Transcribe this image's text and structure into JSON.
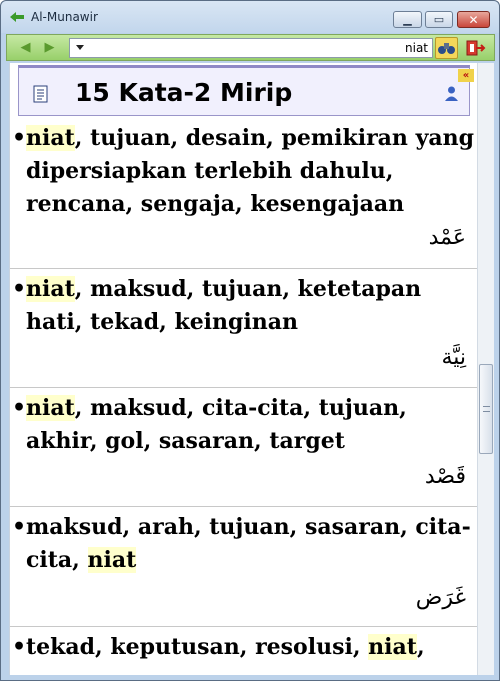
{
  "window": {
    "title": "Al-Munawir"
  },
  "toolbar": {
    "search_value": "niat"
  },
  "header": {
    "title": "15 Kata-2 Mirip",
    "collapse_label": "«"
  },
  "entries": [
    {
      "lines": [
        [
          "niat",
          ", tujuan, desain, pemikiran yang"
        ],
        [
          "",
          "dipersiapkan terlebih dahulu,"
        ],
        [
          "",
          "rencana, sengaja, kesengajaan"
        ]
      ],
      "arabic": "عَمْد"
    },
    {
      "lines": [
        [
          "niat",
          ", maksud, tujuan, ketetapan"
        ],
        [
          "",
          "hati, tekad, keinginan"
        ]
      ],
      "arabic": "نِيَّة"
    },
    {
      "lines": [
        [
          "niat",
          ", maksud, cita-cita, tujuan,"
        ],
        [
          "",
          "akhir, gol, sasaran, target"
        ]
      ],
      "arabic": "قَصْد"
    },
    {
      "lines": [
        [
          "",
          "maksud, arah, tujuan, sasaran, cita-"
        ],
        [
          "",
          "cita, "
        ],
        [
          "niat",
          ""
        ]
      ],
      "arabic": "غَرَض"
    },
    {
      "lines": [
        [
          "",
          "tekad, keputusan, resolusi, "
        ],
        [
          "niat",
          ","
        ]
      ],
      "arabic": ""
    }
  ],
  "icons": {
    "app": "book-arrow-icon",
    "back": "back-arrow-icon",
    "forward": "forward-arrow-icon",
    "search": "search-binoculars-icon",
    "exit": "exit-icon",
    "doc": "document-icon",
    "person": "person-icon"
  },
  "colors": {
    "toolbar": "#a8d87c",
    "highlight": "#ffffcc",
    "header_bg": "#f1f0fd",
    "close_button": "#c9463a"
  }
}
